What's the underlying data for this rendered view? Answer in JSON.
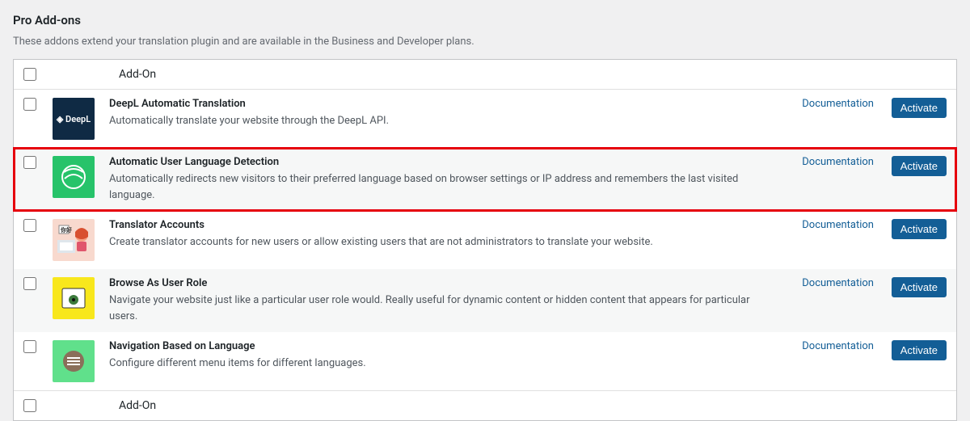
{
  "page": {
    "title": "Pro Add-ons",
    "subtitle": "These addons extend your translation plugin and are available in the Business and Developer plans."
  },
  "table": {
    "header_label": "Add-On",
    "footer_label": "Add-On"
  },
  "common": {
    "documentation": "Documentation",
    "activate": "Activate"
  },
  "addons": [
    {
      "id": "deepl",
      "name": "DeepL Automatic Translation",
      "desc": "Automatically translate your website through the DeepL API.",
      "icon_text": "DeepL"
    },
    {
      "id": "auld",
      "name": "Automatic User Language Detection",
      "desc": "Automatically redirects new visitors to their preferred language based on browser settings or IP address and remembers the last visited language."
    },
    {
      "id": "ta",
      "name": "Translator Accounts",
      "desc": "Create translator accounts for new users or allow existing users that are not administrators to translate your website."
    },
    {
      "id": "baur",
      "name": "Browse As User Role",
      "desc": "Navigate your website just like a particular user role would. Really useful for dynamic content or hidden content that appears for particular users."
    },
    {
      "id": "nav",
      "name": "Navigation Based on Language",
      "desc": "Configure different menu items for different languages."
    }
  ]
}
